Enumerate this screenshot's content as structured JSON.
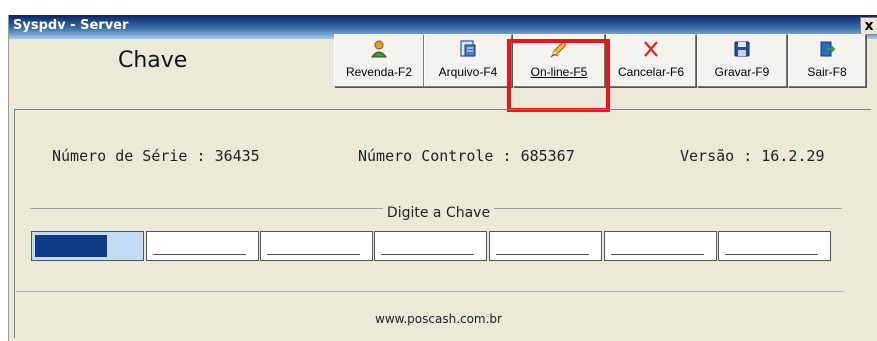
{
  "window": {
    "title": "Syspdv - Server",
    "close_label": "x"
  },
  "header": {
    "label": "Chave"
  },
  "toolbar": {
    "buttons": [
      {
        "label": "Revenda-F2",
        "icon": "user-icon"
      },
      {
        "label": "Arquivo-F4",
        "icon": "file-icon"
      },
      {
        "label": "On-line-F5",
        "icon": "pencil-icon"
      },
      {
        "label": "Cancelar-F6",
        "icon": "cancel-icon"
      },
      {
        "label": "Gravar-F9",
        "icon": "save-icon"
      },
      {
        "label": "Sair-F8",
        "icon": "exit-icon"
      }
    ]
  },
  "info": {
    "serial_label": "Número de Série :",
    "serial_value": "36435",
    "control_label": "Número Controle :",
    "control_value": "685367",
    "version_label": "Versão :",
    "version_value": "16.2.29"
  },
  "key": {
    "prompt": "Digite a Chave",
    "field_count": 7
  },
  "footer": {
    "url": "www.poscash.com.br"
  },
  "colors": {
    "highlight": "#e8161b",
    "active_field": "#0f3a85",
    "title_bar": "#0a246a"
  }
}
